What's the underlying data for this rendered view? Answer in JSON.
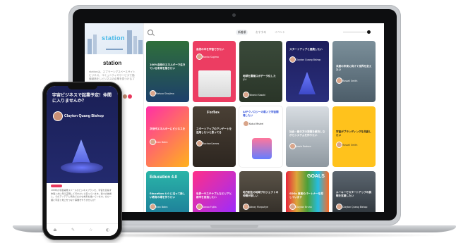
{
  "sidebar": {
    "logo": "station",
    "brand": "station",
    "description": "stationは、スプラーシグスペースサイトビジネス、コミュニティやサービスで価値創造をしビジネスの企業を見つけるプラットフォームです。"
  },
  "topbar": {
    "tabs": [
      "新着順",
      "おすすめ",
      "イベント"
    ]
  },
  "cards": [
    {
      "text": "100%自然のエネルギーで生きている未来を描きたい",
      "name": "Ratsuo Sinojimo"
    },
    {
      "text": "自然の中を宇宙できたい",
      "name": "Ranko Sugimo"
    },
    {
      "text": "地球を農業ロボデータ化したい!",
      "name": "Takashi Sasaki"
    },
    {
      "text": "スタートアップと連携したい",
      "name": "Clayton Quang Bishop"
    },
    {
      "text": "共創の未来に向けて世界を変えたい",
      "name": "Russell Smith"
    },
    {
      "text": "次世代エネルギーにビジネスを",
      "name": "Ivan Batra"
    },
    {
      "text": "スタートアップのアンゲートを活用したいと思ってる",
      "name": "Rachael James"
    },
    {
      "text": "AIテクノロジーの導入で宇宙開発したい",
      "name": "Kokul Mistrel"
    },
    {
      "text": "社会・働き方の課題を解決しながらシステムを作りたい",
      "name": "Jessie Rodson"
    },
    {
      "text": "宇宙がブランディングを共創したい",
      "name": "Russell Smith"
    },
    {
      "text": "Education 4.0 に沿って新しい教育の場を作りたい",
      "name": "Ivan Batra"
    },
    {
      "text": "世界一サステナブルなエリアと都市を目指したい",
      "name": "Sanoo Fujita"
    },
    {
      "text": "地方創生の地域プロジェクトの仲間が欲しい",
      "name": "Adnay Murpuhye"
    },
    {
      "text": "SDGs 事業のパートナーを探しています",
      "name": "Clayton Bruno"
    },
    {
      "text": "ルーキーでスタートアップの挑戦を支援したい",
      "name": "Clayton Quang Bishop"
    }
  ],
  "card_labels": {
    "forbes": "Forbes",
    "education": "Education 4.0",
    "goals": "GOALS"
  },
  "phone": {
    "title": "宇宙ビジネスで起業予定！仲間に入りませんか？",
    "author": "Clayton Quang Bishop",
    "body": "100年の宇宙開発スペースのビジネスプランを、宇宙を目指す仲間と共に考え実現して行きたいと思っています。我々の技術と、そのアイデアと情熱で大きな未来を描いています。ぜひ一緒に宇宙と地上をつなぐ事業をやりませんか？"
  },
  "colors": {
    "accent": "#e8385d",
    "navy": "#1a1f55"
  }
}
